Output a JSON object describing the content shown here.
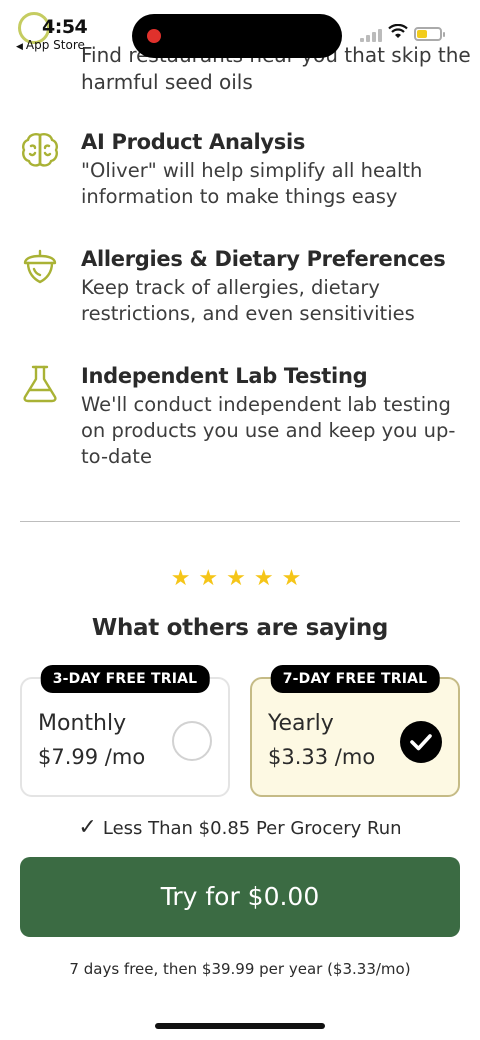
{
  "status_bar": {
    "time": "4:54",
    "back_label": "App Store"
  },
  "features": {
    "top_partial_desc": "Find restaurants near you that skip the harmful seed oils",
    "items": [
      {
        "icon": "brain-icon",
        "title": "AI Product Analysis",
        "desc": "\"Oliver\" will help simplify all health information to make things easy"
      },
      {
        "icon": "acorn-icon",
        "title": "Allergies & Dietary Preferences",
        "desc": "Keep track of allergies, dietary restrictions, and even sensitivities"
      },
      {
        "icon": "flask-icon",
        "title": "Independent Lab Testing",
        "desc": "We'll conduct independent lab testing on products you use and keep you up-to-date"
      }
    ]
  },
  "reviews": {
    "stars": "★★★★★",
    "title": "What others are saying"
  },
  "plans": {
    "monthly": {
      "badge": "3-DAY FREE TRIAL",
      "name": "Monthly",
      "price": "$7.99 /mo",
      "selected": false
    },
    "yearly": {
      "badge": "7-DAY FREE TRIAL",
      "name": "Yearly",
      "price": "$3.33 /mo",
      "selected": true
    }
  },
  "value_line": {
    "check": "✓",
    "text": "Less Than $0.85 Per Grocery Run"
  },
  "cta_label": "Try for $0.00",
  "fine_print": "7 days free, then $39.99 per year ($3.33/mo)",
  "colors": {
    "accent_green": "#3b6b43",
    "icon_olive": "#a9b235",
    "star_gold": "#f5c518",
    "yearly_bg": "#fdf9e3"
  }
}
